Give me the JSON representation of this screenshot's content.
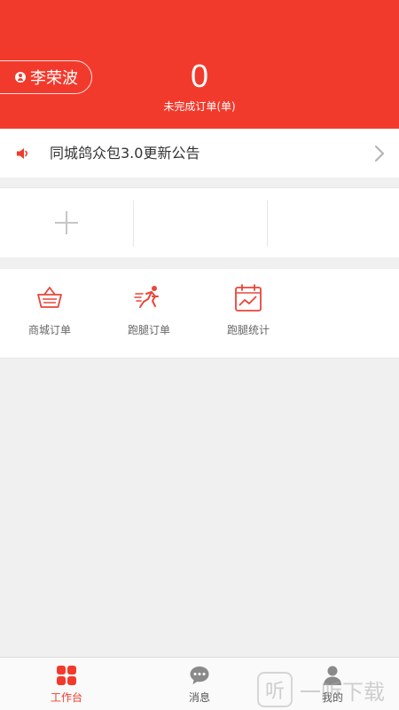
{
  "header": {
    "user_name": "李荣波",
    "pending_orders": "0",
    "pending_orders_label": "未完成订单(单)",
    "accent_color": "#f23a2c"
  },
  "notice": {
    "icon": "speaker-icon",
    "text": "同城鸽众包3.0更新公告",
    "chevron_icon": "chevron-right-icon"
  },
  "slots": {
    "add_icon": "plus-icon"
  },
  "menu": {
    "items": [
      {
        "label": "商城订单",
        "icon": "shopping-basket-icon"
      },
      {
        "label": "跑腿订单",
        "icon": "runner-icon"
      },
      {
        "label": "跑腿统计",
        "icon": "calendar-chart-icon"
      }
    ]
  },
  "tabbar": {
    "tabs": [
      {
        "label": "工作台",
        "icon": "grid-icon",
        "active": true
      },
      {
        "label": "消息",
        "icon": "chat-bubble-icon",
        "active": false
      },
      {
        "label": "我的",
        "icon": "person-icon",
        "active": false
      }
    ]
  },
  "watermark": {
    "logo_text": "听",
    "text": "一听下载"
  }
}
